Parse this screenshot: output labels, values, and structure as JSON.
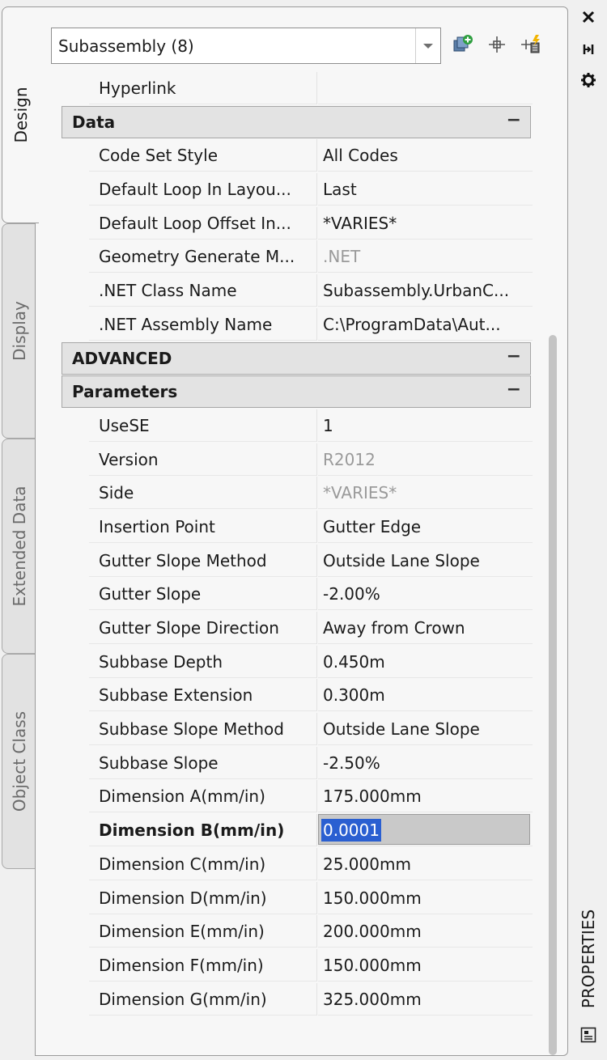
{
  "tabs": [
    {
      "label": "Design",
      "active": true
    },
    {
      "label": "Display",
      "active": false
    },
    {
      "label": "Extended Data",
      "active": false
    },
    {
      "label": "Object Class",
      "active": false
    }
  ],
  "selector": {
    "value": "Subassembly (8)"
  },
  "toolbar": {
    "icons": [
      "add-object-icon",
      "pick-point-icon",
      "quick-select-icon"
    ]
  },
  "strip": {
    "icons": [
      "close-icon",
      "auto-hide-icon",
      "settings-icon",
      "properties-panel-icon"
    ],
    "title": "PROPERTIES"
  },
  "rows": {
    "hyperlink": {
      "label": "Hyperlink",
      "value": ""
    },
    "data_cat": "Data",
    "code_set_style": {
      "label": "Code Set Style",
      "value": "All Codes"
    },
    "default_loop_layout": {
      "label": "Default Loop In Layou...",
      "value": "Last"
    },
    "default_loop_offset": {
      "label": "Default Loop Offset In...",
      "value": "*VARIES*"
    },
    "geometry_generate": {
      "label": "Geometry  Generate  M...",
      "value": ".NET"
    },
    "net_class_name": {
      "label": ".NET Class Name",
      "value": "Subassembly.UrbanC..."
    },
    "net_assembly_name": {
      "label": ".NET Assembly Name",
      "value": "C:\\ProgramData\\Aut..."
    },
    "advanced_cat": "ADVANCED",
    "parameters_cat": "Parameters",
    "usese": {
      "label": "UseSE",
      "value": "1"
    },
    "version": {
      "label": "Version",
      "value": "R2012"
    },
    "side": {
      "label": "Side",
      "value": "*VARIES*"
    },
    "insertion_point": {
      "label": "Insertion Point",
      "value": "Gutter Edge"
    },
    "gutter_slope_method": {
      "label": "Gutter Slope Method",
      "value": "Outside Lane Slope"
    },
    "gutter_slope": {
      "label": "Gutter Slope",
      "value": "-2.00%"
    },
    "gutter_slope_direction": {
      "label": "Gutter Slope Direction",
      "value": "Away from Crown"
    },
    "subbase_depth": {
      "label": "Subbase Depth",
      "value": "0.450m"
    },
    "subbase_extension": {
      "label": "Subbase Extension",
      "value": "0.300m"
    },
    "subbase_slope_method": {
      "label": "Subbase Slope Method",
      "value": "Outside Lane Slope"
    },
    "subbase_slope": {
      "label": "Subbase Slope",
      "value": "-2.50%"
    },
    "dim_a": {
      "label": "Dimension A(mm/in)",
      "value": "175.000mm"
    },
    "dim_b": {
      "label": "Dimension B(mm/in)",
      "value": "0.0001"
    },
    "dim_c": {
      "label": "Dimension C(mm/in)",
      "value": "25.000mm"
    },
    "dim_d": {
      "label": "Dimension D(mm/in)",
      "value": "150.000mm"
    },
    "dim_e": {
      "label": "Dimension E(mm/in)",
      "value": "200.000mm"
    },
    "dim_f": {
      "label": "Dimension F(mm/in)",
      "value": "150.000mm"
    },
    "dim_g": {
      "label": "Dimension G(mm/in)",
      "value": "325.000mm"
    }
  },
  "colors": {
    "selection": "#2a5fd1",
    "category_bg": "#e3e3e3",
    "panel_bg": "#f7f7f7"
  }
}
